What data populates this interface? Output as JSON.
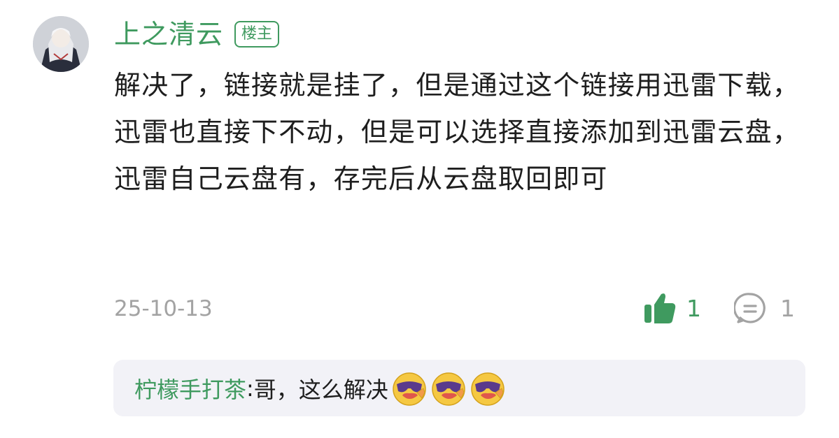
{
  "post": {
    "author": "上之清云",
    "badge": "楼主",
    "content": "解决了，链接就是挂了，但是通过这个链接用迅雷下载，迅雷也直接下不动，但是可以选择直接添加到迅雷云盘，迅雷自己云盘有，存完后从云盘取回即可",
    "date": "25-10-13",
    "likes": "1",
    "replies": "1"
  },
  "sub_reply": {
    "author": "柠檬手打茶",
    "separator": ":",
    "text": " 哥，这么解决",
    "emoji": "sunglasses-laughing-emoji"
  },
  "colors": {
    "accent": "#3f9a5f",
    "muted": "#a3a3a3",
    "sub_bg": "#f2f2f7"
  },
  "icons": {
    "like": "thumbs-up-icon",
    "reply": "comment-icon"
  }
}
